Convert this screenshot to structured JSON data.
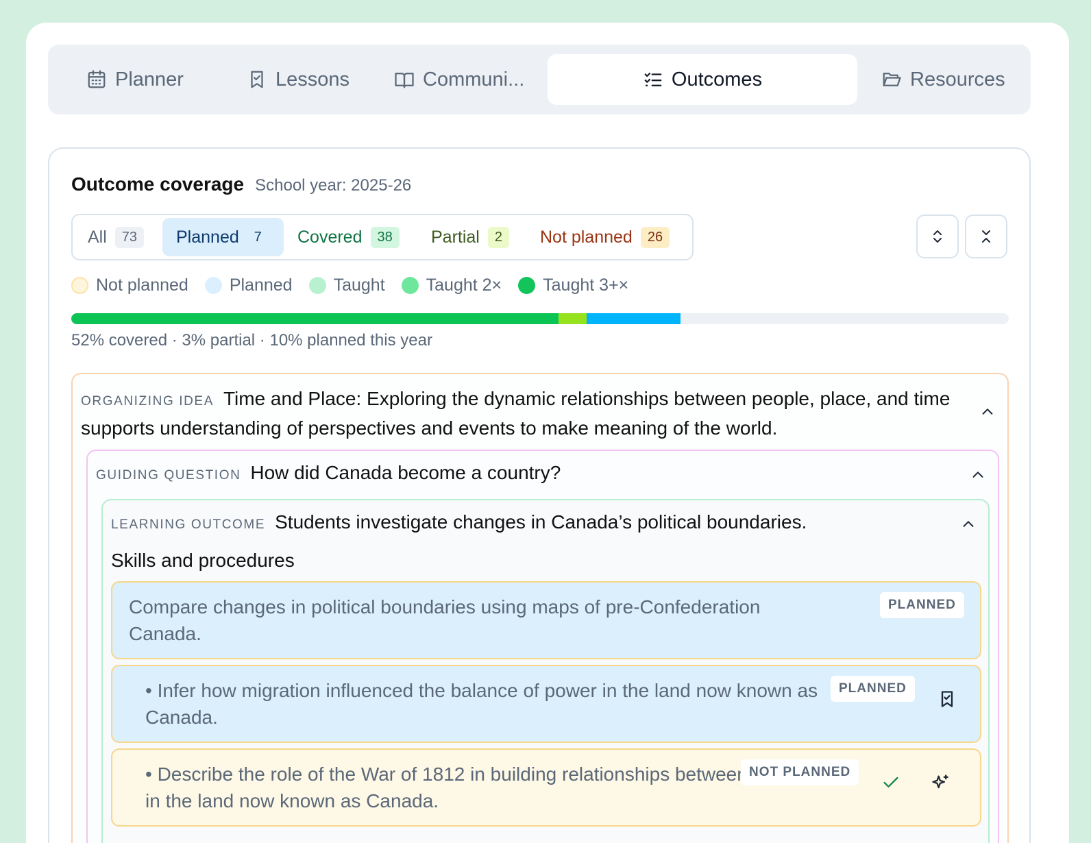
{
  "tabs": [
    {
      "label": "Planner",
      "icon": "calendar-icon"
    },
    {
      "label": "Lessons",
      "icon": "bookmark-icon"
    },
    {
      "label": "Communi...",
      "icon": "book-open-icon"
    },
    {
      "label": "Outcomes",
      "icon": "list-checks-icon",
      "active": true
    },
    {
      "label": "Resources",
      "icon": "folder-open-icon"
    }
  ],
  "coverage": {
    "title": "Outcome coverage",
    "school_year": "School year: 2025-26",
    "filters": [
      {
        "label": "All",
        "count": "73"
      },
      {
        "label": "Planned",
        "count": "7",
        "selected": true
      },
      {
        "label": "Covered",
        "count": "38"
      },
      {
        "label": "Partial",
        "count": "2"
      },
      {
        "label": "Not planned",
        "count": "26"
      }
    ],
    "legend": [
      {
        "label": "Not planned",
        "color": "#fef6dc"
      },
      {
        "label": "Planned",
        "color": "#dcefff"
      },
      {
        "label": "Taught",
        "color": "#b8f1cf"
      },
      {
        "label": "Taught 2×",
        "color": "#6ee79d"
      },
      {
        "label": "Taught 3+×",
        "color": "#12c45a"
      }
    ],
    "progress": {
      "covered": 52,
      "partial": 3,
      "planned": 10
    },
    "summary": "52% covered · 3% partial · 10% planned this year"
  },
  "organizing": {
    "label": "Organizing idea",
    "text": "Time and Place: Exploring the dynamic relationships between people, place, and time supports understanding of perspectives and events to make meaning of the world."
  },
  "guiding": {
    "label": "Guiding question",
    "text": "How did Canada become a country?"
  },
  "outcome": {
    "label": "Learning outcome",
    "text": "Students investigate changes in Canada’s political boundaries.",
    "section": "Skills and procedures",
    "items": [
      {
        "text": "Compare changes in political boundaries using maps of pre-Confederation Canada.",
        "status": "PLANNED"
      },
      {
        "text": "• Infer how migration influenced the balance of power in the land now known as Canada.",
        "status": "PLANNED"
      },
      {
        "text": "• Describe the role of the War of 1812 in building relationships between groups in the land now known as Canada.",
        "status": "NOT PLANNED"
      }
    ]
  },
  "colors": {
    "covered": "#0cc454",
    "partial": "#97e21f",
    "planned": "#00b4fb",
    "planned_bg": "#dbeffc",
    "not_planned_bg": "#fef8e6"
  }
}
